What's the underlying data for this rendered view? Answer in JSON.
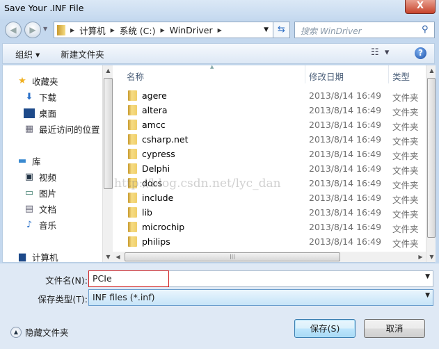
{
  "window": {
    "title": "Save Your .INF File",
    "close_label": "X"
  },
  "address": {
    "crumbs": [
      "计算机",
      "系统 (C:)",
      "WinDriver"
    ],
    "search_placeholder": "搜索 WinDriver"
  },
  "toolbar": {
    "organize": "组织 ▾",
    "new_folder": "新建文件夹"
  },
  "nav": {
    "favorites": {
      "label": "收藏夹",
      "items": [
        "下载",
        "桌面",
        "最近访问的位置"
      ]
    },
    "libraries": {
      "label": "库",
      "items": [
        "视频",
        "图片",
        "文档",
        "音乐"
      ]
    },
    "computer": "计算机"
  },
  "columns": {
    "name": "名称",
    "date": "修改日期",
    "type": "类型"
  },
  "files": [
    {
      "name": "agere",
      "date": "2013/8/14 16:49",
      "type": "文件夹"
    },
    {
      "name": "altera",
      "date": "2013/8/14 16:49",
      "type": "文件夹"
    },
    {
      "name": "amcc",
      "date": "2013/8/14 16:49",
      "type": "文件夹"
    },
    {
      "name": "csharp.net",
      "date": "2013/8/14 16:49",
      "type": "文件夹"
    },
    {
      "name": "cypress",
      "date": "2013/8/14 16:49",
      "type": "文件夹"
    },
    {
      "name": "Delphi",
      "date": "2013/8/14 16:49",
      "type": "文件夹"
    },
    {
      "name": "docs",
      "date": "2013/8/14 16:49",
      "type": "文件夹"
    },
    {
      "name": "include",
      "date": "2013/8/14 16:49",
      "type": "文件夹"
    },
    {
      "name": "lib",
      "date": "2013/8/14 16:49",
      "type": "文件夹"
    },
    {
      "name": "microchip",
      "date": "2013/8/14 16:49",
      "type": "文件夹"
    },
    {
      "name": "philips",
      "date": "2013/8/14 16:49",
      "type": "文件夹"
    }
  ],
  "watermark": "http://blog.csdn.net/lyc_dan",
  "form": {
    "filename_label": "文件名(N):",
    "filename_value": "PCIe",
    "type_label": "保存类型(T):",
    "type_value": "INF files (*.inf)"
  },
  "buttons": {
    "save": "保存(S)",
    "cancel": "取消",
    "hide_folders": "隐藏文件夹"
  }
}
